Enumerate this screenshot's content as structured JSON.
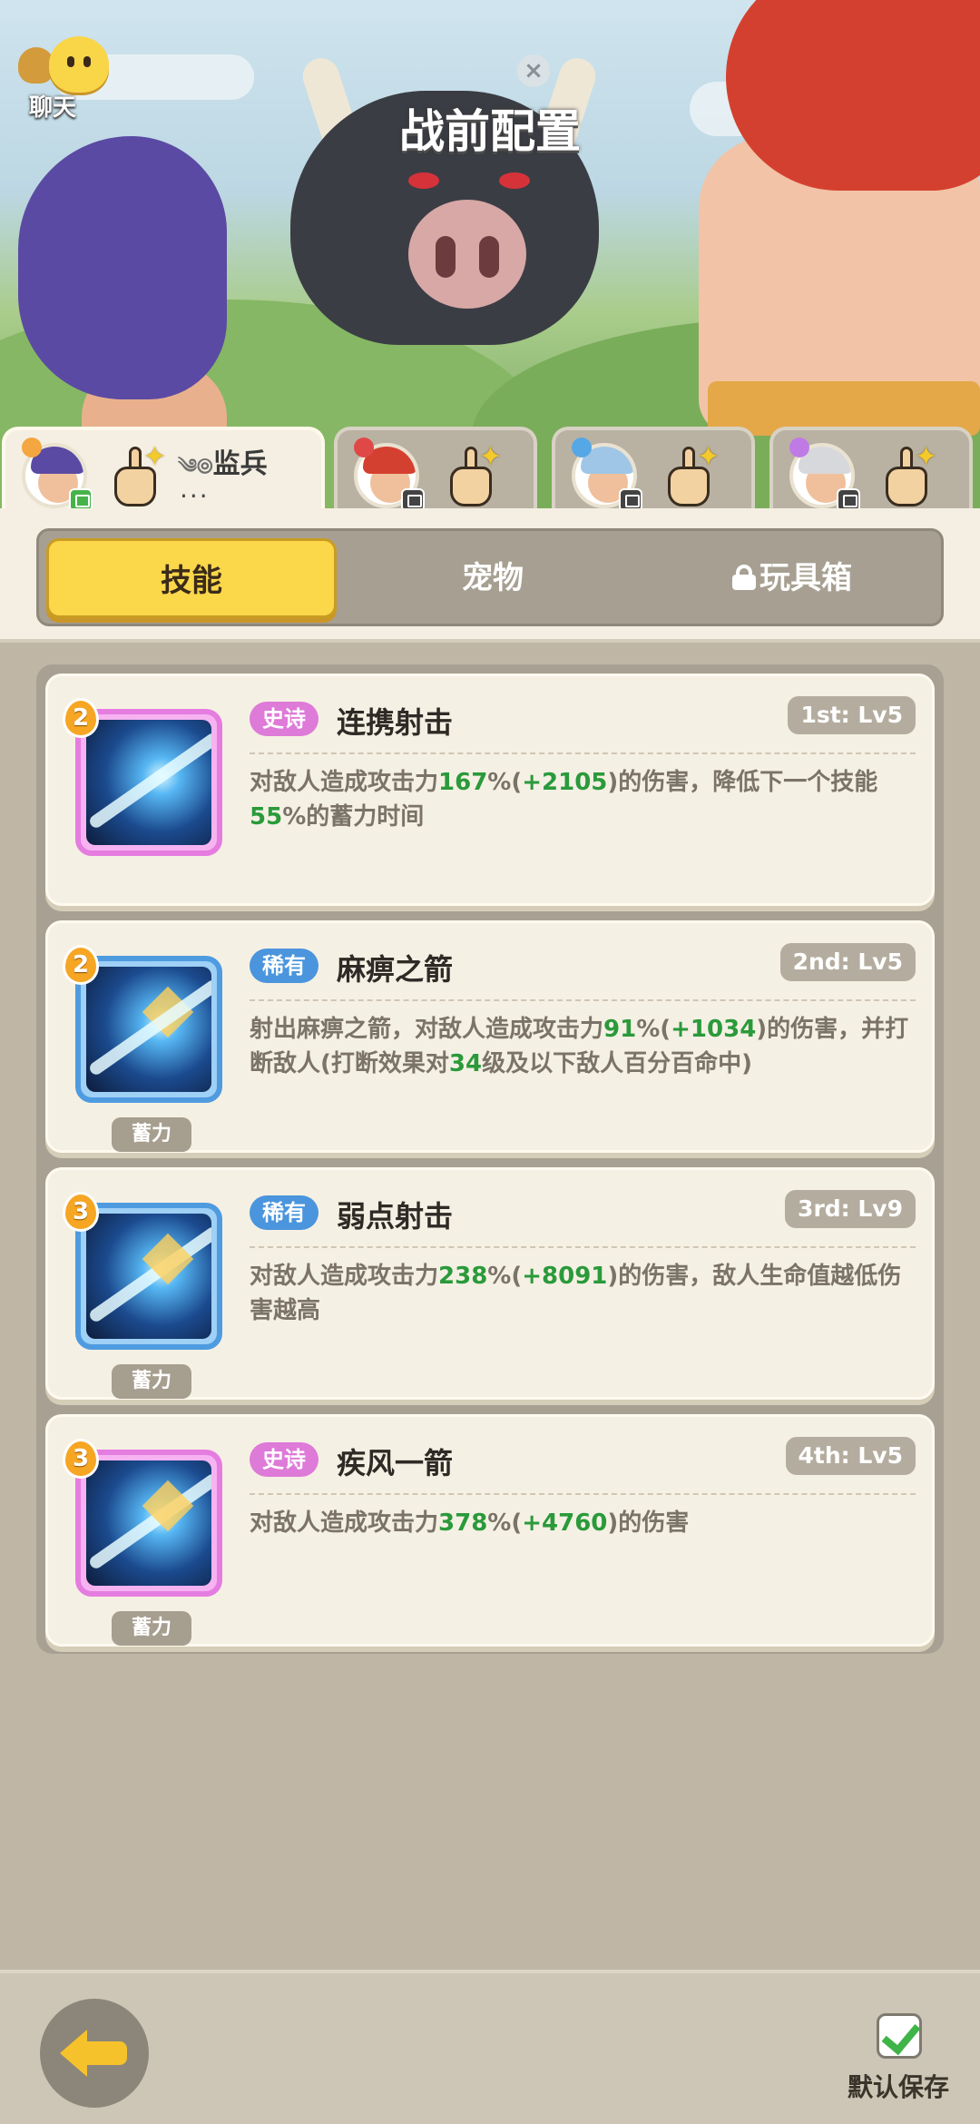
{
  "header": {
    "title": "战前配置",
    "chat_label": "聊天"
  },
  "hero_tabs": [
    {
      "name": "监兵",
      "sub": "...",
      "active": true,
      "avatar_icon": "archer-avatar-icon",
      "hint_icon": "tap-hand-icon"
    },
    {
      "name": "",
      "active": false,
      "avatar_icon": "warrior-avatar-icon",
      "hint_icon": "tap-hand-icon"
    },
    {
      "name": "",
      "active": false,
      "avatar_icon": "mage-avatar-icon",
      "hint_icon": "tap-hand-icon"
    },
    {
      "name": "",
      "active": false,
      "avatar_icon": "priest-avatar-icon",
      "hint_icon": "tap-hand-icon"
    }
  ],
  "category_tabs": {
    "skills": "技能",
    "pets": "宠物",
    "toybox": "玩具箱"
  },
  "skills": [
    {
      "rank": "2",
      "rarity": "史诗",
      "name": "连携射击",
      "level": "1st: Lv5",
      "desc_parts": [
        "对敌人造成攻击力",
        "167",
        "%(",
        "+2105",
        ")的伤害，降低下一个技能",
        "55",
        "%的蓄力时间"
      ],
      "charge": ""
    },
    {
      "rank": "2",
      "rarity": "稀有",
      "name": "麻痹之箭",
      "level": "2nd: Lv5",
      "desc_parts": [
        "射出麻痹之箭，对敌人造成攻击力",
        "91",
        "%(",
        "+1034",
        ")的伤害，并打断敌人(打断效果对",
        "34",
        "级及以下敌人百分百命中)"
      ],
      "charge": "蓄力"
    },
    {
      "rank": "3",
      "rarity": "稀有",
      "name": "弱点射击",
      "level": "3rd: Lv9",
      "desc_parts": [
        "对敌人造成攻击力",
        "238",
        "%(",
        "+8091",
        ")的伤害，敌人生命值越低伤害越高"
      ],
      "charge": "蓄力"
    },
    {
      "rank": "3",
      "rarity": "史诗",
      "name": "疾风一箭",
      "level": "4th: Lv5",
      "desc_parts": [
        "对敌人造成攻击力",
        "378",
        "%(",
        "+4760",
        ")的伤害"
      ],
      "charge": "蓄力"
    }
  ],
  "footer": {
    "save_label": "默认保存",
    "save_checked": true
  },
  "colors": {
    "highlight_green": "#2a9a3a",
    "epic": "#de7ad8",
    "rare": "#4a95dd",
    "tab_active": "#fbd74a"
  }
}
